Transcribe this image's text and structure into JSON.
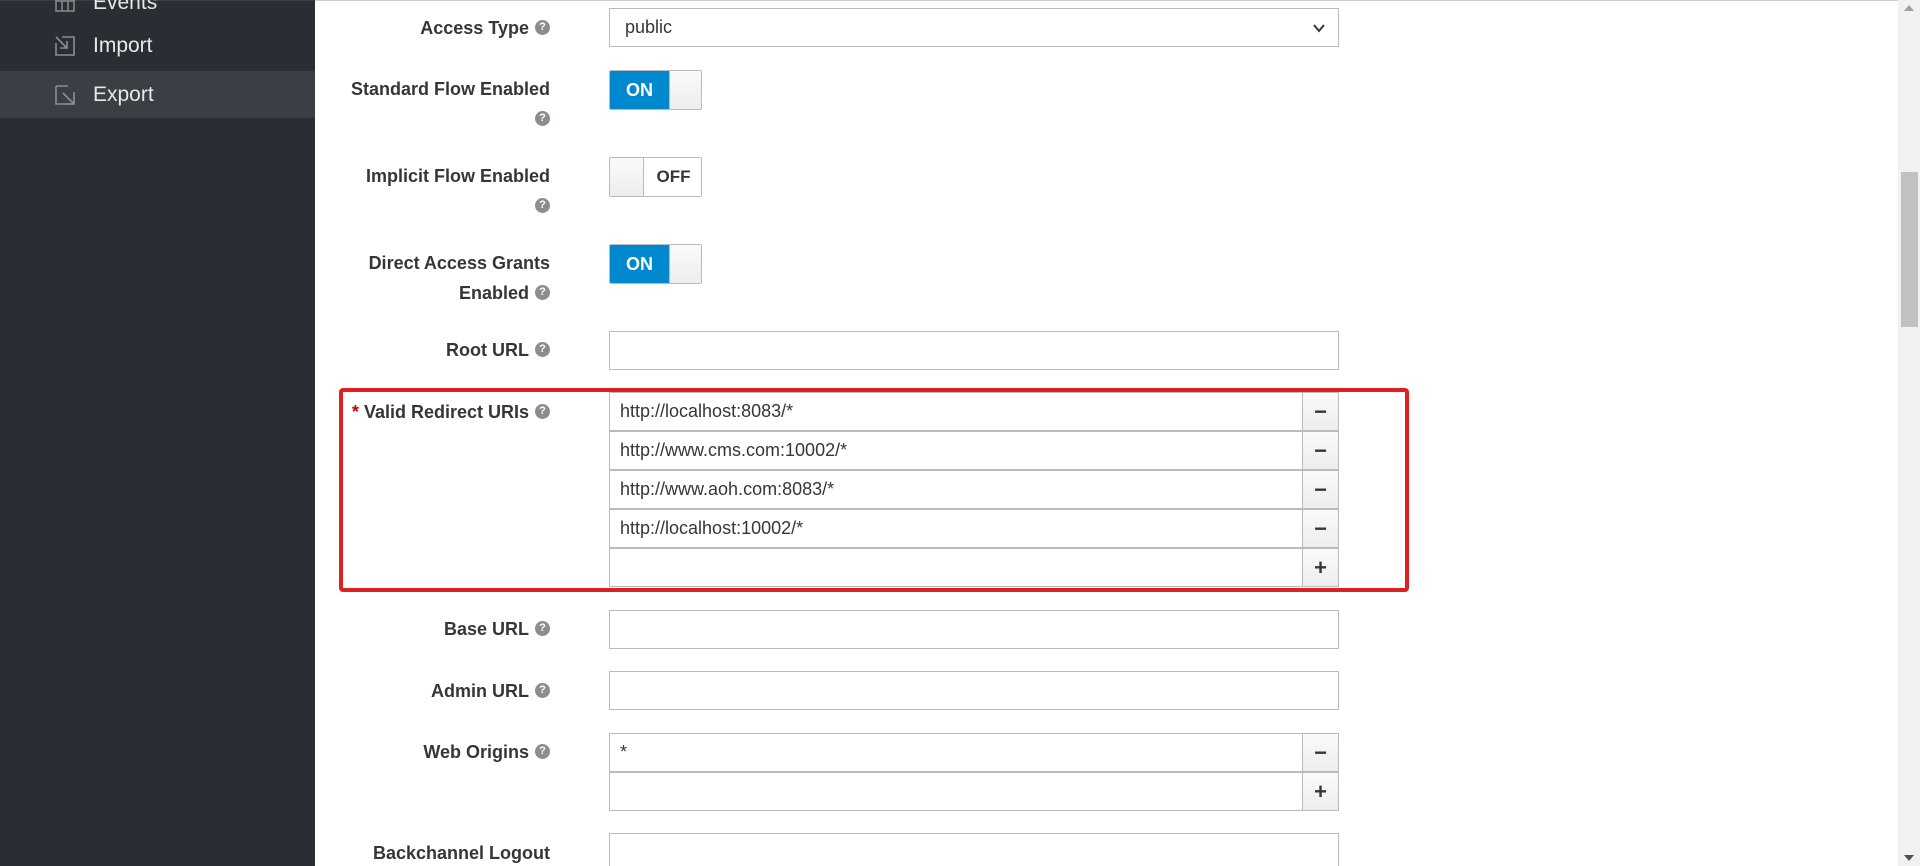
{
  "sidebar": {
    "items": [
      {
        "label": "Events",
        "icon": "calendar-icon"
      },
      {
        "label": "Import",
        "icon": "import-icon"
      },
      {
        "label": "Export",
        "icon": "export-icon",
        "active": true
      }
    ]
  },
  "form": {
    "access_type": {
      "label": "Access Type",
      "value": "public"
    },
    "standard_flow": {
      "label_line1": "Standard Flow Enabled",
      "state": "ON"
    },
    "implicit_flow": {
      "label_line1": "Implicit Flow Enabled",
      "state": "OFF"
    },
    "direct_access": {
      "label_line1": "Direct Access Grants",
      "label_line2": "Enabled",
      "state": "ON"
    },
    "root_url": {
      "label": "Root URL",
      "value": ""
    },
    "valid_redirect_uris": {
      "required_mark": "*",
      "label": "Valid Redirect URIs",
      "values": [
        "http://localhost:8083/*",
        "http://www.cms.com:10002/*",
        "http://www.aoh.com:8083/*",
        "http://localhost:10002/*"
      ],
      "new_value": ""
    },
    "base_url": {
      "label": "Base URL",
      "value": ""
    },
    "admin_url": {
      "label": "Admin URL",
      "value": ""
    },
    "web_origins": {
      "label": "Web Origins",
      "values": [
        "*"
      ],
      "new_value": ""
    },
    "backchannel_logout": {
      "label": "Backchannel Logout",
      "value": ""
    }
  },
  "help_glyph": "?",
  "remove_glyph": "−",
  "add_glyph": "+",
  "colors": {
    "sidebar_bg": "#292e34",
    "sidebar_active": "#393f44",
    "toggle_on": "#0088ce",
    "highlight": "#e02020"
  }
}
